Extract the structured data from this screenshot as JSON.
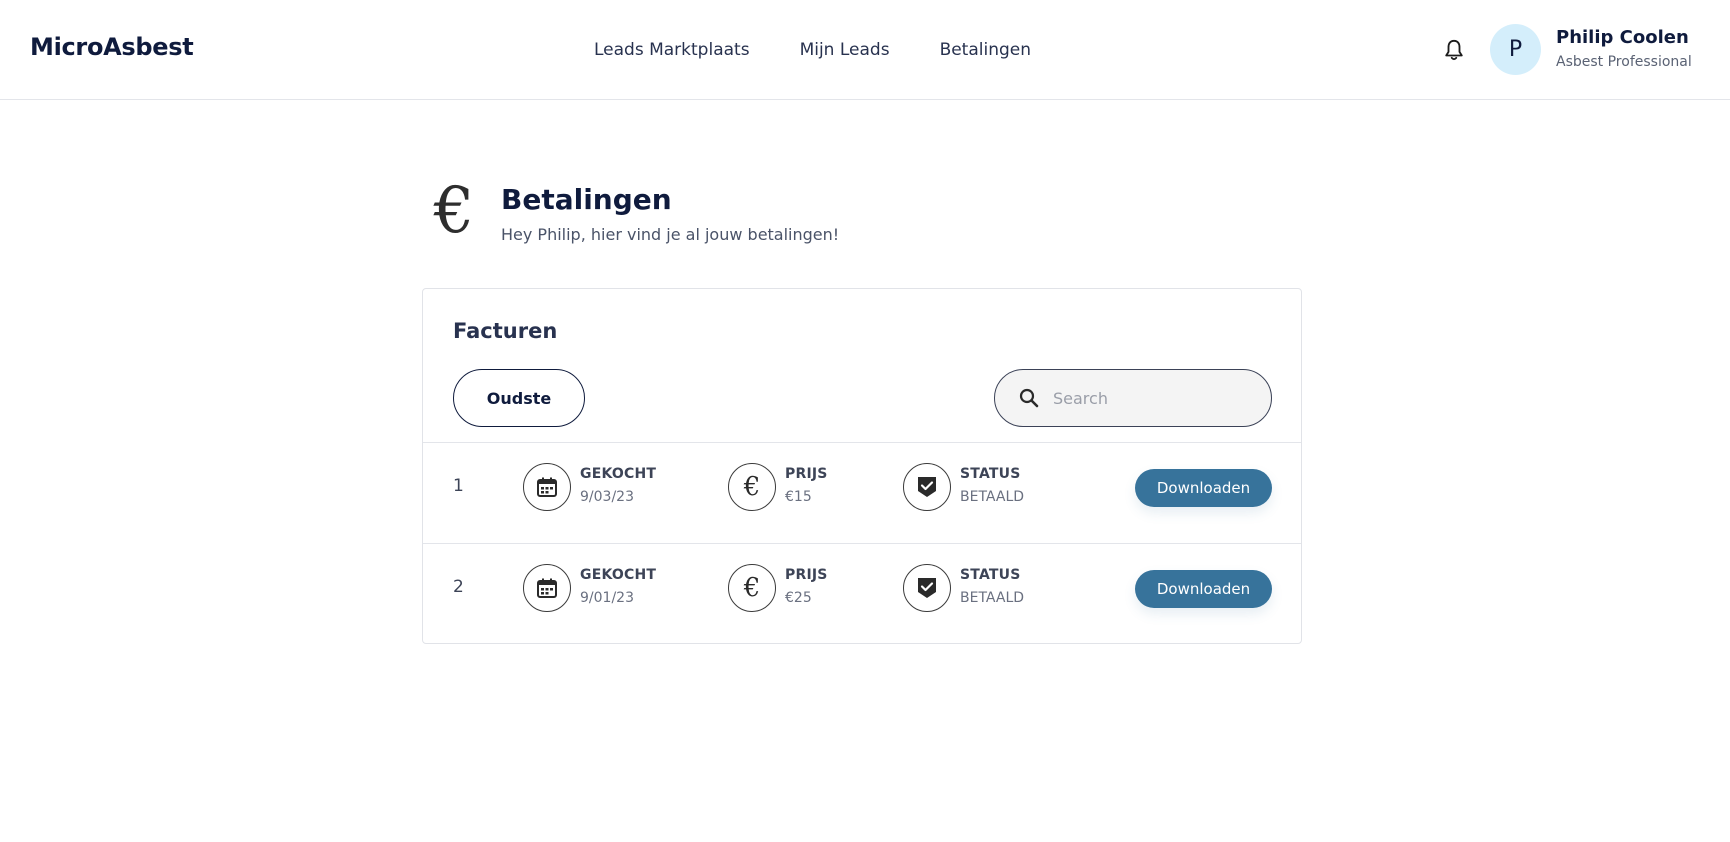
{
  "header": {
    "brand": "MicroAsbest",
    "nav": [
      {
        "label": "Leads Marktplaats"
      },
      {
        "label": "Mijn Leads"
      },
      {
        "label": "Betalingen"
      }
    ],
    "user": {
      "initial": "P",
      "name": "Philip Coolen",
      "role": "Asbest Professional"
    }
  },
  "page": {
    "icon": "euro-icon",
    "icon_glyph": "€",
    "title": "Betalingen",
    "subtitle": "Hey Philip, hier vind je al jouw betalingen!"
  },
  "invoices": {
    "title": "Facturen",
    "sort_label": "Oudste",
    "search_placeholder": "Search",
    "rows": [
      {
        "index": "1",
        "bought_label": "GEKOCHT",
        "bought": "9/03/23",
        "price_label": "PRIJS",
        "price": "€15",
        "status_label": "STATUS",
        "status": "BETAALD",
        "action": "Downloaden"
      },
      {
        "index": "2",
        "bought_label": "GEKOCHT",
        "bought": "9/01/23",
        "price_label": "PRIJS",
        "price": "€25",
        "status_label": "STATUS",
        "status": "BETAALD",
        "action": "Downloaden"
      }
    ]
  },
  "colors": {
    "primary": "#37739b",
    "text_dark": "#0f1b3d",
    "avatar_bg": "#d4eefb"
  }
}
